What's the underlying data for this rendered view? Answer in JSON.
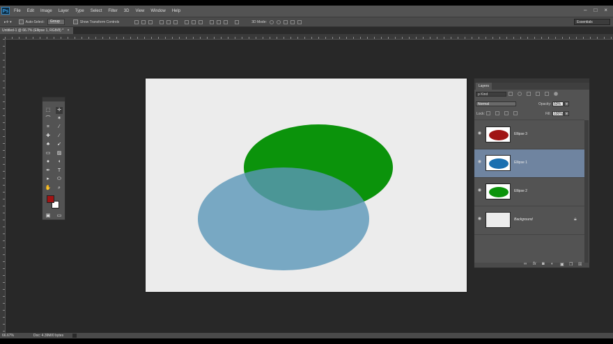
{
  "app": {
    "logo": "Ps"
  },
  "menu": [
    "File",
    "Edit",
    "Image",
    "Layer",
    "Type",
    "Select",
    "Filter",
    "3D",
    "View",
    "Window",
    "Help"
  ],
  "window_controls": {
    "minimize": "–",
    "restore": "□",
    "close": "×"
  },
  "options_bar": {
    "auto_select_label": "Auto-Select:",
    "auto_select_value": "Group",
    "show_transform_label": "Show Transform Controls",
    "mode_3d_label": "3D Mode:",
    "workspace": "Essentials"
  },
  "document": {
    "tab_title": "Untitled-1 @ 66.7% (Ellipse 1, RGB/8) *",
    "close": "×"
  },
  "canvas": {
    "background": "#ececec",
    "shapes": [
      {
        "name": "Ellipse 2",
        "color": "#0b930b",
        "opacity": 1.0
      },
      {
        "name": "Ellipse 1",
        "color": "#5b97b9",
        "opacity": 0.8
      }
    ]
  },
  "layers_panel": {
    "tab": "Layers",
    "kind_filter": "ρ Kind",
    "blend_mode": "Normal",
    "opacity_label": "Opacity:",
    "opacity_value": "53%",
    "lock_label": "Lock:",
    "fill_label": "Fill:",
    "fill_value": "100%",
    "layers": [
      {
        "name": "Ellipse 3",
        "thumb_color": "#a01414",
        "selected": false
      },
      {
        "name": "Ellipse 1",
        "thumb_color": "#1a6fb0",
        "selected": true
      },
      {
        "name": "Ellipse 2",
        "thumb_color": "#0b930b",
        "selected": false
      },
      {
        "name": "Background",
        "thumb_color": "#ececec",
        "selected": false
      }
    ],
    "footer_icons": [
      "link-icon",
      "fx-icon",
      "mask-icon",
      "adjustment-icon",
      "group-icon",
      "new-layer-icon",
      "trash-icon"
    ],
    "footer_glyphs": {
      "link": "∞",
      "fx": "fx",
      "mask": "◙",
      "adjust": "◐",
      "group": "▣",
      "new": "❐",
      "trash": "☒"
    }
  },
  "tools_panel": {
    "foreground_color": "#a01414",
    "background_color": "#ffffff",
    "glyphs": {
      "marquee": "⬚",
      "move": "✛",
      "lasso": "⌒",
      "wand": "✶",
      "crop": "⌗",
      "eyedropper": "⁄",
      "heal": "✚",
      "brush": "∕",
      "stamp": "♣",
      "history": "➹",
      "eraser": "▭",
      "gradient": "▨",
      "blur": "●",
      "dodge": "◖",
      "pen": "✒",
      "type": "T",
      "path": "▸",
      "shape": "⬭",
      "hand": "✋",
      "zoom": "⌕",
      "screen": "▭",
      "quickmask": "▣"
    }
  },
  "status_bar": {
    "zoom": "66.67%",
    "doc": "Doc: 4.39M/0 bytes"
  }
}
